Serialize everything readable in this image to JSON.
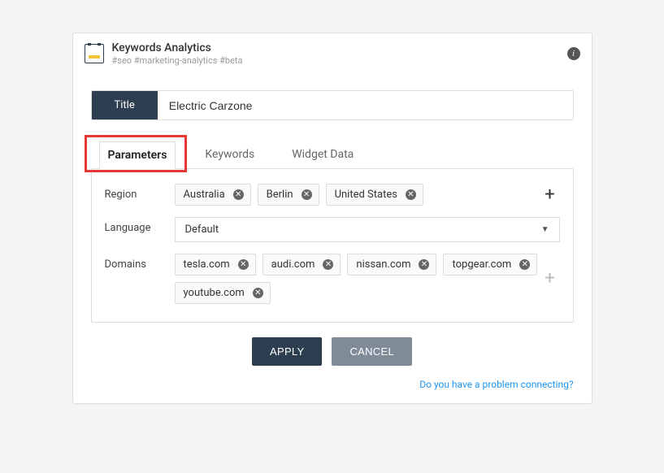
{
  "header": {
    "title": "Keywords Analytics",
    "subtitle": "#seo #marketing-analytics #beta"
  },
  "title_field": {
    "label": "Title",
    "value": "Electric Carzone"
  },
  "tabs": [
    {
      "label": "Parameters",
      "active": true
    },
    {
      "label": "Keywords",
      "active": false
    },
    {
      "label": "Widget Data",
      "active": false
    }
  ],
  "params": {
    "region": {
      "label": "Region",
      "chips": [
        "Australia",
        "Berlin",
        "United States"
      ]
    },
    "language": {
      "label": "Language",
      "value": "Default"
    },
    "domains": {
      "label": "Domains",
      "chips": [
        "tesla.com",
        "audi.com",
        "nissan.com",
        "topgear.com",
        "youtube.com"
      ]
    }
  },
  "actions": {
    "apply": "APPLY",
    "cancel": "CANCEL"
  },
  "footer": {
    "help_link": "Do you have a problem connecting?"
  }
}
